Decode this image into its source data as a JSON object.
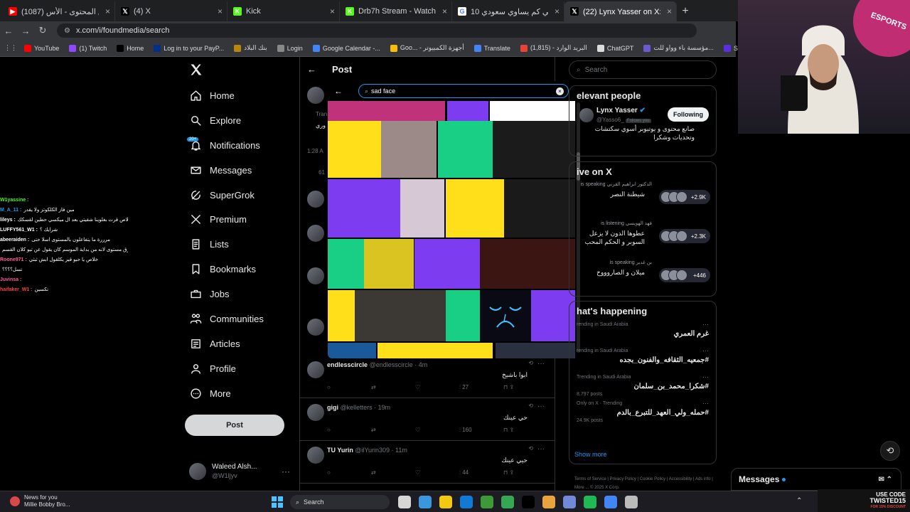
{
  "browser": {
    "tabs": [
      {
        "title": "(1087) دوري صناع المحتوى - الأس...",
        "fav_color": "#ff0000",
        "fav_glyph": "▶",
        "active": false
      },
      {
        "title": "(4) X",
        "fav_color": "#000000",
        "fav_glyph": "𝕏",
        "active": false
      },
      {
        "title": "Kick",
        "fav_color": "#53fc18",
        "fav_glyph": "K",
        "active": false
      },
      {
        "title": "Drb7h Stream - Watch Live on K...",
        "fav_color": "#53fc18",
        "fav_glyph": "K",
        "active": false
      },
      {
        "title": "10 ريال يمني كم يساوي سعودي",
        "fav_color": "#ffffff",
        "fav_glyph": "G",
        "active": false
      },
      {
        "title": "(22) Lynx Yasser on X: \"جاهزين...",
        "fav_color": "#000000",
        "fav_glyph": "𝕏",
        "active": true
      }
    ],
    "url": "x.com/i/foundmedia/search",
    "bookmarks": [
      {
        "label": "YouTube",
        "color": "#ff0000"
      },
      {
        "label": "(1) Twitch",
        "color": "#9146ff"
      },
      {
        "label": "Home",
        "color": "#000000"
      },
      {
        "label": "Log in to your PayP...",
        "color": "#003087"
      },
      {
        "label": "بنك البلاد",
        "color": "#b8860b"
      },
      {
        "label": "Login",
        "color": "#888888"
      },
      {
        "label": "Google Calendar -...",
        "color": "#4285f4"
      },
      {
        "label": "Goo... - أجهزة الكمبيوتر",
        "color": "#fbbc05"
      },
      {
        "label": "Translate",
        "color": "#4285f4"
      },
      {
        "label": "(1,815) - البريد الوارد",
        "color": "#ea4335"
      },
      {
        "label": "ChatGPT",
        "color": "#dddddd"
      },
      {
        "label": "مؤسسة باء وواو للت...",
        "color": "#6a5acd"
      },
      {
        "label": "StreamElements - M...",
        "color": "#5b2ee0"
      }
    ]
  },
  "stream_chat": [
    {
      "user": "W1yassine :",
      "text": "",
      "color": "#53fc18"
    },
    {
      "user": "M_A_11 :",
      "text": "مين فاز الكلكوتز ولا يقدر",
      "color": "#1d9bf0"
    },
    {
      "user": "lileys :",
      "text": "خلاص قرت بغلوينا شقيتي بعد ال ميكسي حطين لقسكك",
      "color": "#ffffff"
    },
    {
      "user": "LUFFY561_W1 :",
      "text": "شرايك ؟",
      "color": "#ffffff"
    },
    {
      "user": "abeeraiden :",
      "text": "مرررة ما يتفاعلون بالمستوى اسلا حتى",
      "color": "#ffffff"
    },
    {
      "user": "",
      "text": "شارق مستوى لانه من بداية الموسم كان يقول عن تبو كلان القسم",
      "color": "#ffffff"
    },
    {
      "user": "Roone971 :",
      "text": "خلاص يا حبو قيز يكلقول ابش ثبثي",
      "color": "#ff5f9e"
    },
    {
      "user": "",
      "text": "تسل؟؟؟؟",
      "color": "#ffffff"
    },
    {
      "user": "Juvinsa :",
      "text": "",
      "color": "#ff5f9e"
    },
    {
      "user": "haifaker_W1 :",
      "text": "تكسين",
      "color": "#ff4444"
    }
  ],
  "nav": {
    "items": [
      {
        "label": "Home",
        "icon": "home-icon"
      },
      {
        "label": "Explore",
        "icon": "search-icon"
      },
      {
        "label": "Notifications",
        "icon": "bell-icon"
      },
      {
        "label": "Messages",
        "icon": "envelope-icon"
      },
      {
        "label": "SuperGrok",
        "icon": "grok-icon"
      },
      {
        "label": "Premium",
        "icon": "x-icon"
      },
      {
        "label": "Lists",
        "icon": "list-icon"
      },
      {
        "label": "Bookmarks",
        "icon": "bookmark-icon"
      },
      {
        "label": "Jobs",
        "icon": "briefcase-icon"
      },
      {
        "label": "Communities",
        "icon": "people-icon"
      },
      {
        "label": "Articles",
        "icon": "article-icon"
      },
      {
        "label": "Profile",
        "icon": "person-icon"
      },
      {
        "label": "More",
        "icon": "more-icon"
      }
    ],
    "notifications_badge": "20+",
    "post_label": "Post",
    "account": {
      "name": "Waleed Alsh...",
      "handle": "@W1ljyv"
    }
  },
  "center": {
    "title": "Post",
    "ghost_text": [
      "Tran",
      "وري",
      "1:28 A",
      "61"
    ],
    "tweets": [
      {
        "name": "endlesscircle",
        "handle": "@endlesscircle · 4m",
        "body": "ابوا باشيخ",
        "views": "27"
      },
      {
        "name": "gigi",
        "handle": "@kelletters · 19m",
        "body": "حي عينك",
        "views": "160"
      },
      {
        "name": "TU Yurin",
        "handle": "@ilYurin309 · 11m",
        "body": "حيي عينك",
        "views": "44"
      }
    ]
  },
  "gif_picker": {
    "query": "sad face",
    "tiles": [
      {
        "color": "#c0327a"
      },
      {
        "color": "#7d3cf0"
      },
      {
        "color": "#ffffff"
      },
      {
        "color": "#ffde1a"
      },
      {
        "color": "#9b8a88"
      },
      {
        "color": "#19cf86"
      },
      {
        "color": "#1b1b1b"
      },
      {
        "color": "#7d3cf0"
      },
      {
        "color": "#d6c8d5"
      },
      {
        "color": "#ffde1a"
      },
      {
        "color": "#1a1a1a"
      },
      {
        "color": "#19cf86"
      },
      {
        "color": "#d9c421"
      },
      {
        "color": "#7d3cf0"
      },
      {
        "color": "#3a1512"
      },
      {
        "color": "#ffde1a"
      },
      {
        "color": "#3c3834"
      },
      {
        "color": "#19cf86"
      },
      {
        "color": "#0a0a14"
      },
      {
        "color": "#7d3cf0"
      },
      {
        "color": "#1a5a9a"
      },
      {
        "color": "#ffde1a"
      },
      {
        "color": "#2a3040"
      }
    ]
  },
  "right": {
    "search_placeholder": "Search",
    "relevant_title": "elevant people",
    "person": {
      "name": "Lynx Yasser",
      "handle": "@Yasso6_",
      "follows_you": "Follows you",
      "bio": "صانع محتوى و يوتيوبر أسوي سكتشات وتحديات وشكرا",
      "button": "Following"
    },
    "live_title": "ive on X",
    "spaces": [
      {
        "host": "الدكتور ابراهيم القرني is speaking",
        "title": "شيطنة النصر",
        "count": "+2.9K"
      },
      {
        "host": "فهد الهويسي is listening",
        "title": "عطوها الدون لا يزعل السوبر و الحكم المحب",
        "count": "+2.3K"
      },
      {
        "host": "بن غدير is speaking",
        "title": "ميلان و الصاروووخ",
        "count": "+446"
      }
    ],
    "happening_title": "hat's happening",
    "trends": [
      {
        "context": "rending in Saudi Arabia",
        "name": "غرم العمري",
        "count": ""
      },
      {
        "context": "rending in Saudi Arabia",
        "name": "#جمعيه_الثقافه_والفنون_بجده",
        "count": ""
      },
      {
        "context": "Trending in Saudi Arabia",
        "name": "#شكرا_محمد_بن_سلمان",
        "count": "8,797 posts"
      },
      {
        "context": "Only on X · Trending",
        "name": "#حمله_ولي_العهد_للتبرع_بالدم",
        "count": "24.9K posts"
      }
    ],
    "show_more": "Show more",
    "footer": "Terms of Service  |  Privacy Policy  |  Cookie Policy  |  Accessibility  |  Ads info  |  More ...  © 2025 X Corp."
  },
  "messages_drawer": {
    "label": "Messages"
  },
  "taskbar": {
    "news_title": "News for you",
    "news_sub": "Millie Bobby Bro...",
    "search": "Search",
    "apps": [
      "#d6d6d6",
      "#3a96dd",
      "#f2c811",
      "#0f7bd6",
      "#3c9a39",
      "#34a853",
      "#000000",
      "#e8a33d",
      "#7289da",
      "#1db954",
      "#4285f4",
      "#bbbbbb"
    ]
  },
  "promo": {
    "line1": "USE CODE",
    "line2": "TWISTED15",
    "line3": "FOR 15% DISCOUNT"
  },
  "colors": {
    "accent": "#1d9bf0",
    "bg": "#000000",
    "border": "#2f3336"
  }
}
